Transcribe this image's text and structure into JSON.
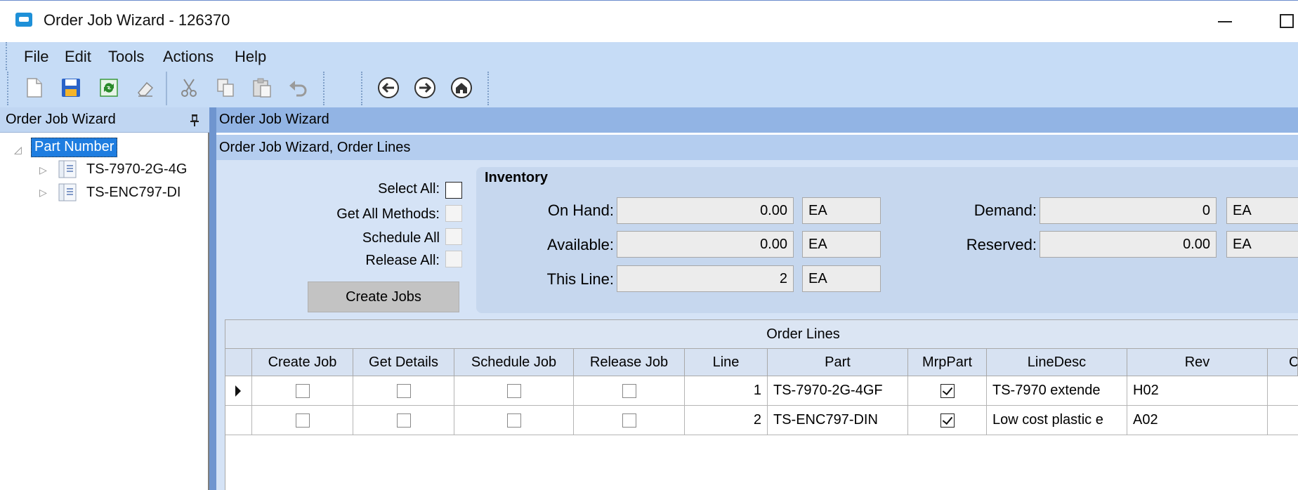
{
  "window": {
    "title": "Order Job Wizard - 126370"
  },
  "menu": [
    "File",
    "Edit",
    "Tools",
    "Actions",
    "Help"
  ],
  "toolbar": {
    "icons": [
      "new-icon",
      "save-icon",
      "refresh-icon",
      "clear-icon",
      "cut-icon",
      "copy-icon",
      "paste-icon",
      "undo-icon",
      "back-icon",
      "forward-icon",
      "home-icon"
    ]
  },
  "left_panel": {
    "title": "Order Job Wizard",
    "tree": {
      "root": "Part Number",
      "children": [
        "TS-7970-2G-4G",
        "TS-ENC797-DI"
      ]
    }
  },
  "main": {
    "header": "Order Job Wizard",
    "subheader": "Order Job Wizard, Order Lines",
    "options": {
      "select_all": "Select All:",
      "get_all_methods": "Get All Methods:",
      "schedule_all": "Schedule All",
      "release_all": "Release All:",
      "create_jobs": "Create Jobs"
    },
    "inventory": {
      "title": "Inventory",
      "on_hand_label": "On Hand:",
      "on_hand_value": "0.00",
      "on_hand_uom": "EA",
      "available_label": "Available:",
      "available_value": "0.00",
      "available_uom": "EA",
      "this_line_label": "This Line:",
      "this_line_value": "2",
      "this_line_uom": "EA",
      "demand_label": "Demand:",
      "demand_value": "0",
      "demand_uom": "EA",
      "reserved_label": "Reserved:",
      "reserved_value": "0.00",
      "reserved_uom": "EA"
    },
    "grid": {
      "title": "Order Lines",
      "columns": [
        "Create Job",
        "Get Details",
        "Schedule Job",
        "Release Job",
        "Line",
        "Part",
        "MrpPart",
        "LineDesc",
        "Rev",
        "C"
      ],
      "rows": [
        {
          "create_job": false,
          "get_details": false,
          "schedule_job": false,
          "release_job": false,
          "line": "1",
          "part": "TS-7970-2G-4GF",
          "mrp_part": true,
          "line_desc": "TS-7970 extende",
          "rev": "H02"
        },
        {
          "create_job": false,
          "get_details": false,
          "schedule_job": false,
          "release_job": false,
          "line": "2",
          "part": "TS-ENC797-DIN",
          "mrp_part": true,
          "line_desc": "Low cost plastic e",
          "rev": "A02"
        }
      ]
    }
  }
}
